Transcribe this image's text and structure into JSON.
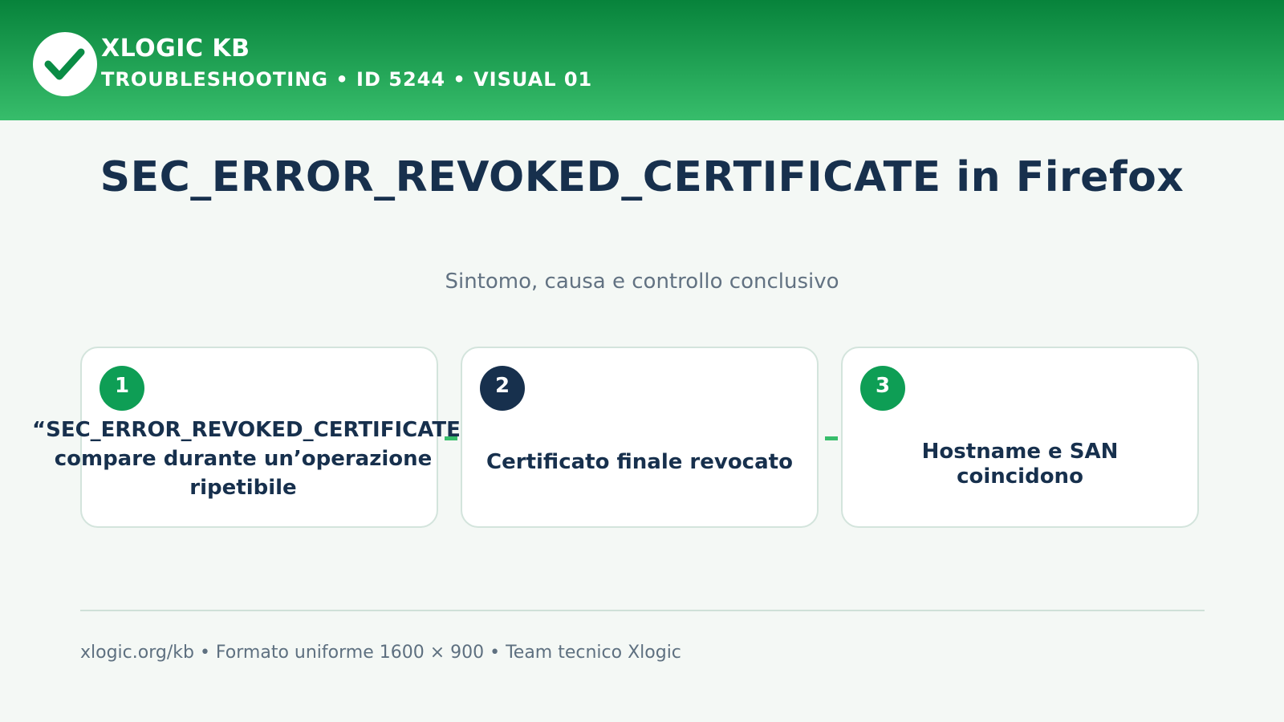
{
  "header": {
    "brand": "XLOGIC KB",
    "breadcrumb": "TROUBLESHOOTING • ID 5244 • VISUAL 01",
    "logo_icon": "check-icon",
    "colors": {
      "gradient_top": "#07833b",
      "gradient_bottom": "#37bd6b"
    }
  },
  "title": "SEC_ERROR_REVOKED_CERTIFICATE in Firefox",
  "subtitle": "Sintomo, causa e controllo conclusivo",
  "steps": [
    {
      "number": "1",
      "badge_color": "#0e9e55",
      "text": "“SEC_ERROR_REVOKED_CERTIFICATE” compare durante un’operazione ripetibile"
    },
    {
      "number": "2",
      "badge_color": "#17304d",
      "text": "Certificato finale revocato"
    },
    {
      "number": "3",
      "badge_color": "#0e9e55",
      "text": "Hostname e SAN coincidono"
    }
  ],
  "footer": "xlogic.org/kb • Formato uniforme 1600 × 900 • Team tecnico Xlogic",
  "colors": {
    "accent": "#37bd6b",
    "navy": "#17304d",
    "background": "#f4f8f5"
  }
}
